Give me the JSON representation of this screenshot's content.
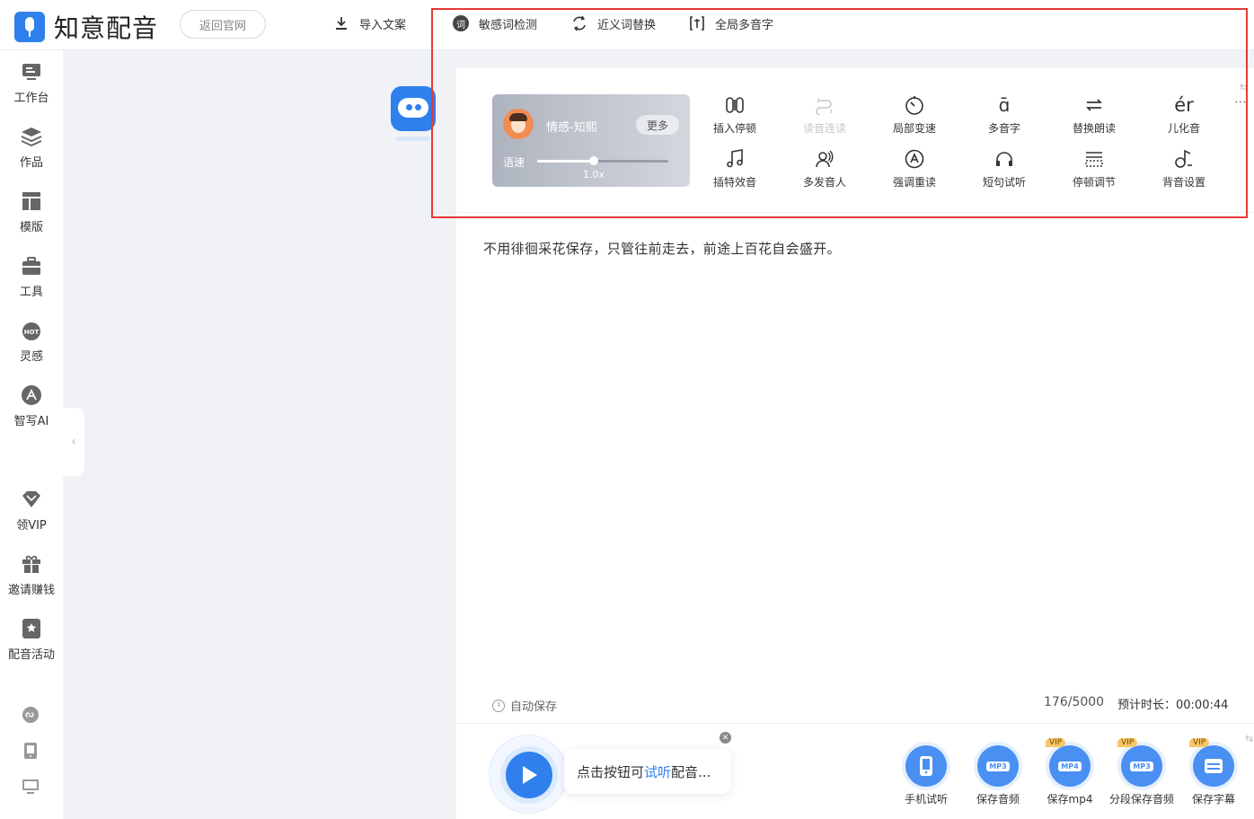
{
  "app": {
    "name": "知意配音",
    "back_label": "返回官网"
  },
  "header": {
    "import_label": "导入文案",
    "sensitive_icon_char": "词",
    "sensitive_label": "敏感词检测",
    "synonym_label": "近义词替换",
    "polyphone_label": "全局多音字"
  },
  "sidebar": {
    "items": [
      {
        "label": "工作台",
        "icon": "monitor-icon"
      },
      {
        "label": "作品",
        "icon": "layers-icon"
      },
      {
        "label": "模版",
        "icon": "template-icon"
      },
      {
        "label": "工具",
        "icon": "toolbox-icon"
      },
      {
        "label": "灵感",
        "icon": "hot-icon"
      },
      {
        "label": "智写AI",
        "icon": "ai-pen-icon"
      },
      {
        "label": "领VIP",
        "icon": "diamond-icon"
      },
      {
        "label": "邀请赚钱",
        "icon": "gift-icon"
      },
      {
        "label": "配音活动",
        "icon": "activity-icon"
      }
    ],
    "hot_text": "HOT",
    "bottom_icons": [
      "mini-program-icon",
      "mobile-icon",
      "desktop-icon"
    ]
  },
  "voice_card": {
    "name": "情感-知熙",
    "more_label": "更多",
    "speed_label": "语速",
    "speed_value": "1.0x",
    "speed_fraction": 0.43
  },
  "tools": {
    "row1": [
      {
        "label": "插入停顿",
        "icon": "pause-insert-icon",
        "enabled": true
      },
      {
        "label": "读音连读",
        "icon": "liaison-icon",
        "enabled": false
      },
      {
        "label": "局部变速",
        "icon": "speed-dial-icon",
        "enabled": true
      },
      {
        "label": "多音字",
        "icon": "polyphone-icon",
        "enabled": true
      },
      {
        "label": "替换朗读",
        "icon": "swap-read-icon",
        "enabled": true
      },
      {
        "label": "儿化音",
        "icon": "erhua-icon",
        "enabled": true
      }
    ],
    "row2": [
      {
        "label": "插特效音",
        "icon": "music-note-icon",
        "enabled": true
      },
      {
        "label": "多发音人",
        "icon": "multi-speaker-icon",
        "enabled": true
      },
      {
        "label": "强调重读",
        "icon": "emphasis-icon",
        "enabled": true
      },
      {
        "label": "短句试听",
        "icon": "headphones-icon",
        "enabled": true
      },
      {
        "label": "停顿调节",
        "icon": "pause-adjust-icon",
        "enabled": true
      },
      {
        "label": "背音设置",
        "icon": "bgm-icon",
        "enabled": true
      }
    ],
    "polyphone_glyph": "ɑ̄",
    "erhua_glyph": "ér"
  },
  "editor": {
    "text": "不用徘徊采花保存，只管往前走去，前途上百花自会盛开。",
    "autosave_label": "自动保存",
    "word_count": "176/5000",
    "duration": "预计时长：00:00:44"
  },
  "player": {
    "tip_prefix": "点击按钮可",
    "tip_highlight": "试听",
    "tip_suffix": "配音..."
  },
  "save_actions": [
    {
      "label": "手机试听",
      "icon": "phone-listen-icon",
      "vip": false,
      "format": ""
    },
    {
      "label": "保存音频",
      "icon": "mp3-icon",
      "vip": false,
      "format": "MP3"
    },
    {
      "label": "保存mp4",
      "icon": "mp4-icon",
      "vip": true,
      "format": "MP4"
    },
    {
      "label": "分段保存音频",
      "icon": "mp3-icon",
      "vip": true,
      "format": "MP3"
    },
    {
      "label": "保存字幕",
      "icon": "subtitle-icon",
      "vip": true,
      "format": ""
    }
  ],
  "vip_label": "VIP",
  "colors": {
    "brand": "#2f80ed",
    "annotation": "#e53935"
  }
}
